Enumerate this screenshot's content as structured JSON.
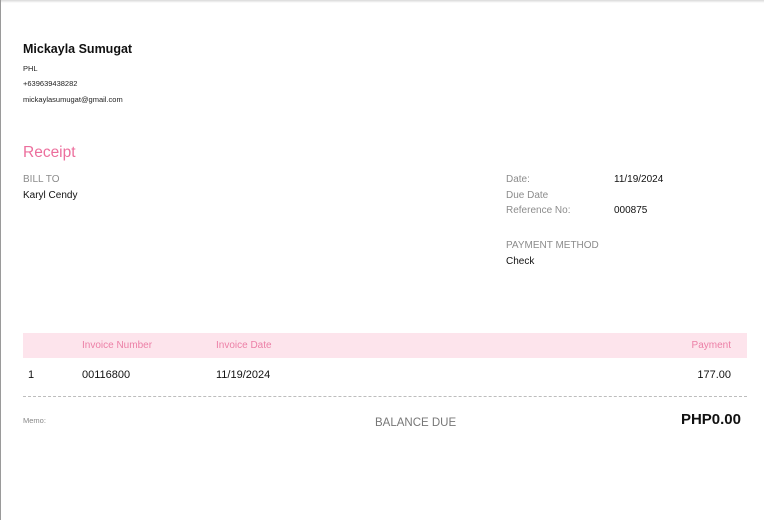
{
  "business": {
    "name": "Mickayla Sumugat",
    "country": "PHL",
    "phone": "+639639438282",
    "email": "mickaylasumugat@gmail.com"
  },
  "document": {
    "title": "Receipt",
    "bill_to_label": "BILL TO",
    "bill_to_name": "Karyl Cendy"
  },
  "details": {
    "date_label": "Date:",
    "date_value": "11/19/2024",
    "due_date_label": "Due Date",
    "reference_label": "Reference No:",
    "reference_value": "000875",
    "payment_method_label": "PAYMENT METHOD",
    "payment_method_value": "Check"
  },
  "table": {
    "headers": [
      "",
      "Invoice Number",
      "Invoice Date",
      "Payment"
    ],
    "rows": [
      [
        "1",
        "00116800",
        "11/19/2024",
        "177.00"
      ]
    ]
  },
  "footer": {
    "memo_label": "Memo:",
    "balance_label": "BALANCE DUE",
    "balance_value": "PHP0.00"
  },
  "colors": {
    "accent": "#ec6f9d",
    "table_header_bg": "#fde4ec"
  }
}
